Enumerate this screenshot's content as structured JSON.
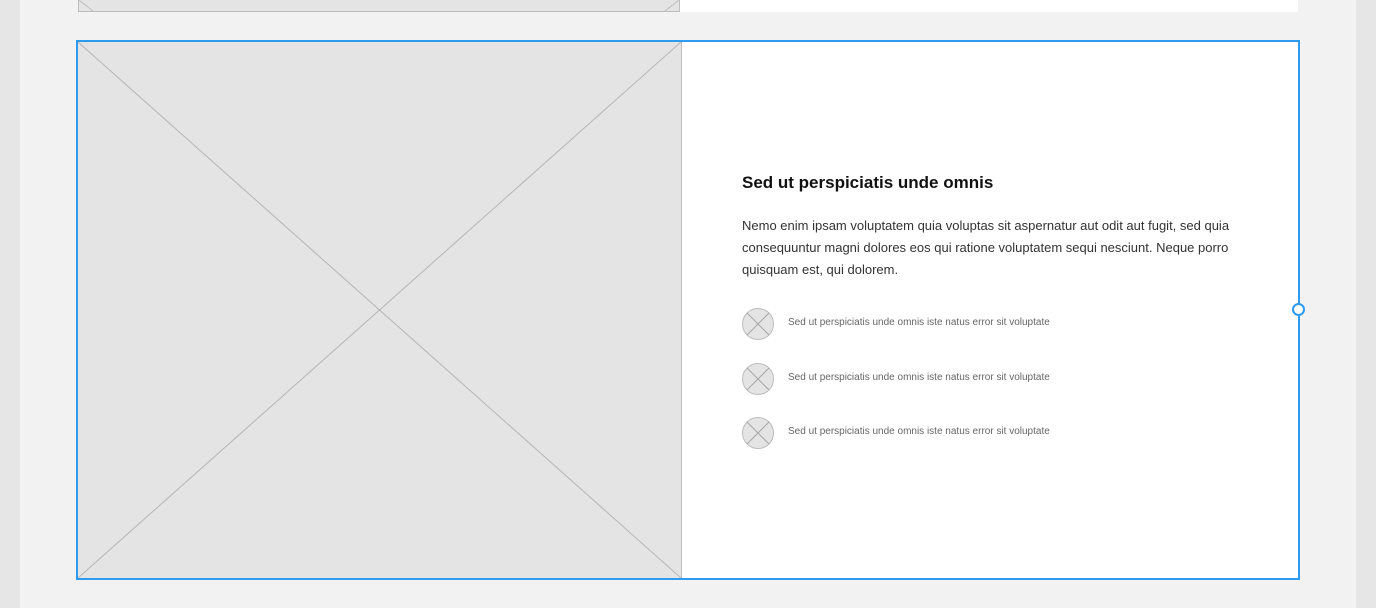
{
  "section": {
    "heading": "Sed ut perspiciatis unde omnis",
    "body": "Nemo enim ipsam voluptatem quia voluptas sit aspernatur aut odit aut fugit, sed quia consequuntur magni dolores eos qui ratione voluptatem sequi nesciunt. Neque porro quisquam est, qui dolorem.",
    "features": [
      {
        "icon": "image-placeholder-icon",
        "label": "Sed ut perspiciatis unde omnis iste natus error sit voluptate"
      },
      {
        "icon": "image-placeholder-icon",
        "label": "Sed ut perspiciatis unde omnis iste natus error sit voluptate"
      },
      {
        "icon": "image-placeholder-icon",
        "label": "Sed ut perspiciatis unde omnis iste natus error sit voluptate"
      }
    ]
  },
  "colors": {
    "selection": "#2e9bf0",
    "placeholder_fill": "#e4e4e4",
    "canvas": "#f2f2f2"
  }
}
